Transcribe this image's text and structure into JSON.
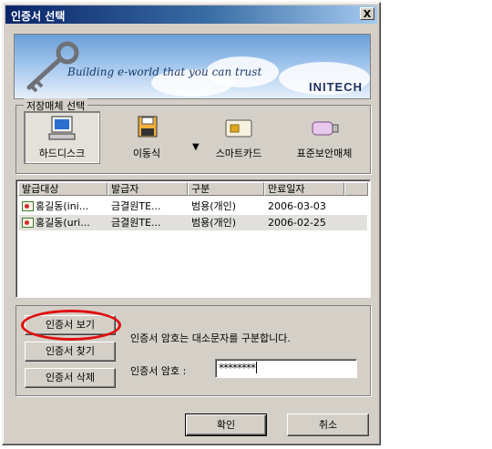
{
  "window": {
    "title": "인증서 선택",
    "close_label": "X"
  },
  "banner": {
    "tagline": "Building e-world that you can trust",
    "brand": "INITECH"
  },
  "storage": {
    "legend": "저장매체 선택",
    "media": [
      {
        "label": "하드디스크",
        "icon": "hard-disk-icon",
        "selected": true
      },
      {
        "label": "이동식",
        "icon": "removable-disk-icon",
        "selected": false
      },
      {
        "label": "스마트카드",
        "icon": "smart-card-icon",
        "selected": false
      },
      {
        "label": "표준보안매체",
        "icon": "usb-token-icon",
        "selected": false
      }
    ]
  },
  "cert_list": {
    "columns": [
      "발급대상",
      "발급자",
      "구분",
      "만료일자"
    ],
    "rows": [
      {
        "subject": "홍길동(ini...",
        "issuer": "금결원TE...",
        "type": "범용(개인)",
        "expiry": "2006-03-03",
        "highlighted": false
      },
      {
        "subject": "홍길동(uri...",
        "issuer": "금결원TE...",
        "type": "범용(개인)",
        "expiry": "2006-02-25",
        "highlighted": true
      }
    ]
  },
  "actions": {
    "view_cert": "인증서 보기",
    "find_cert": "인증서 찾기",
    "delete_cert": "인증서 삭제"
  },
  "password": {
    "note": "인증서 암호는 대소문자를 구분합니다.",
    "label": "인증서 암호 :",
    "value": "********"
  },
  "footer": {
    "ok": "확인",
    "cancel": "취소"
  },
  "colors": {
    "title_start": "#0a246a",
    "title_end": "#a6caf0",
    "highlight_ring": "#e01010",
    "dialog_bg": "#d4d0c8"
  }
}
